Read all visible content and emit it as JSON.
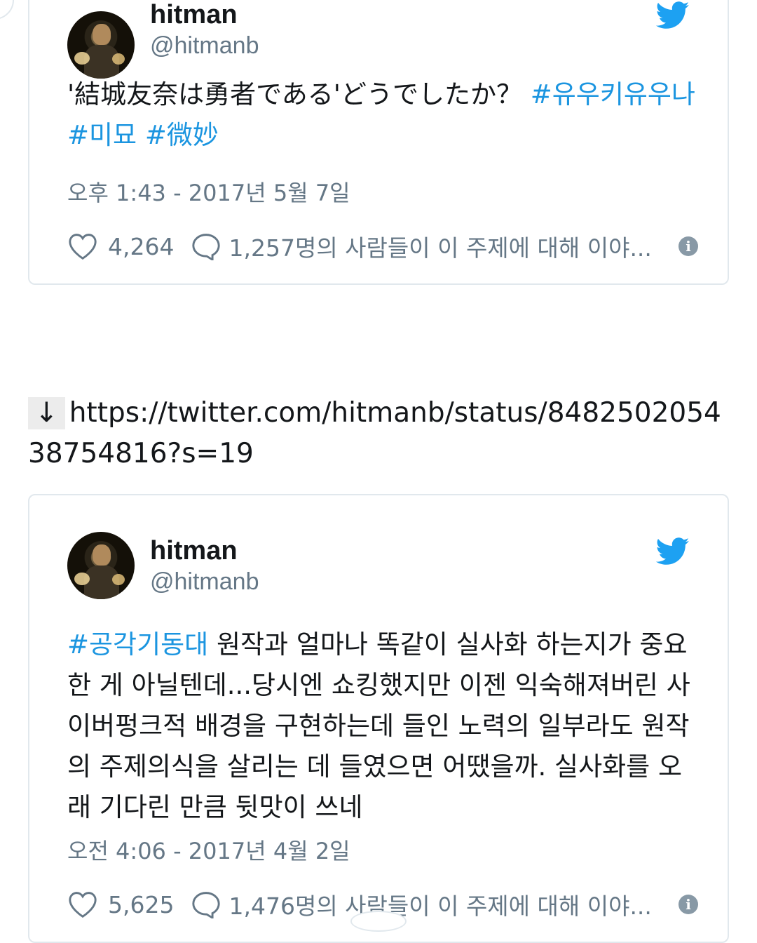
{
  "tweets": [
    {
      "name": "hitman",
      "handle": "@hitmanb",
      "text_parts": [
        {
          "text": "'結城友奈は勇者である'どうでしたか？ ",
          "hashtag": false
        },
        {
          "text": "#유우키유우나",
          "hashtag": true
        },
        {
          "text": " ",
          "hashtag": false
        },
        {
          "text": "#미묘",
          "hashtag": true
        },
        {
          "text": " ",
          "hashtag": false
        },
        {
          "text": "#微妙",
          "hashtag": true
        }
      ],
      "timestamp": "오후 1:43 - 2017년 5월 7일",
      "likes": "4,264",
      "conversation": "1,257명의 사람들이 이 주제에 대해 이야..."
    },
    {
      "name": "hitman",
      "handle": "@hitmanb",
      "text_parts": [
        {
          "text": "#공각기동대",
          "hashtag": true
        },
        {
          "text": " 원작과 얼마나 똑같이 실사화 하는지가 중요한 게 아닐텐데...당시엔 쇼킹했지만 이젠 익숙해져버린 사이버펑크적 배경을 구현하는데 들인 노력의 일부라도 원작의 주제의식을 살리는 데 들였으면 어땠을까. 실사화를 오래 기다린 만큼 뒷맛이 쓰네",
          "hashtag": false
        }
      ],
      "timestamp": "오전 4:06 - 2017년 4월 2일",
      "likes": "5,625",
      "conversation": "1,476명의 사람들이 이 주제에 대해 이야..."
    }
  ],
  "link": {
    "arrow": "↓",
    "url": "https://twitter.com/hitmanb/status/848250205438754816?s=19"
  },
  "icons": {
    "bird": "twitter-bird-icon",
    "heart": "heart-icon",
    "bubble": "speech-bubble-icon",
    "info": "info-icon"
  },
  "colors": {
    "hashtag": "#1b95e0",
    "twitter_blue": "#1da1f2",
    "muted": "#657786",
    "border": "#e1e8ed"
  }
}
